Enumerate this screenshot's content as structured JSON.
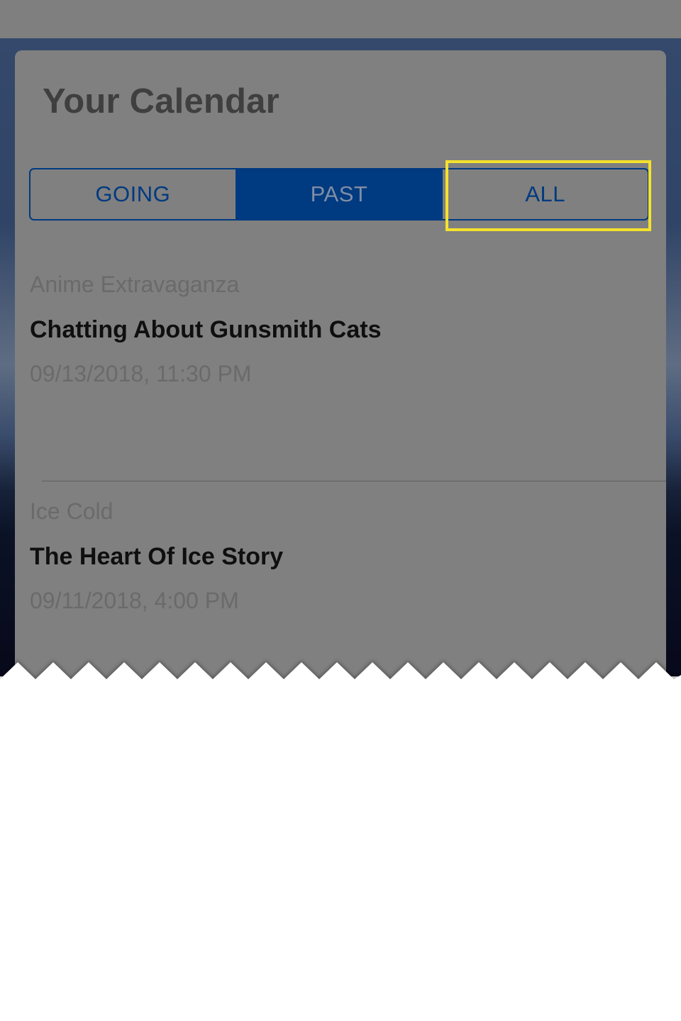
{
  "calendar": {
    "title": "Your Calendar",
    "tabs": [
      {
        "label": "GOING",
        "active": false
      },
      {
        "label": "PAST",
        "active": true
      },
      {
        "label": "ALL",
        "active": false
      }
    ],
    "events": [
      {
        "organizer": "Anime Extravaganza",
        "title": "Chatting About Gunsmith Cats",
        "datetime": "09/13/2018, 11:30 PM"
      },
      {
        "organizer": "Ice Cold",
        "title": "The Heart Of Ice Story",
        "datetime": "09/11/2018, 4:00 PM"
      }
    ]
  },
  "colors": {
    "accent": "#003a80",
    "highlight": "#f4e22d",
    "overlay": "#808080"
  }
}
